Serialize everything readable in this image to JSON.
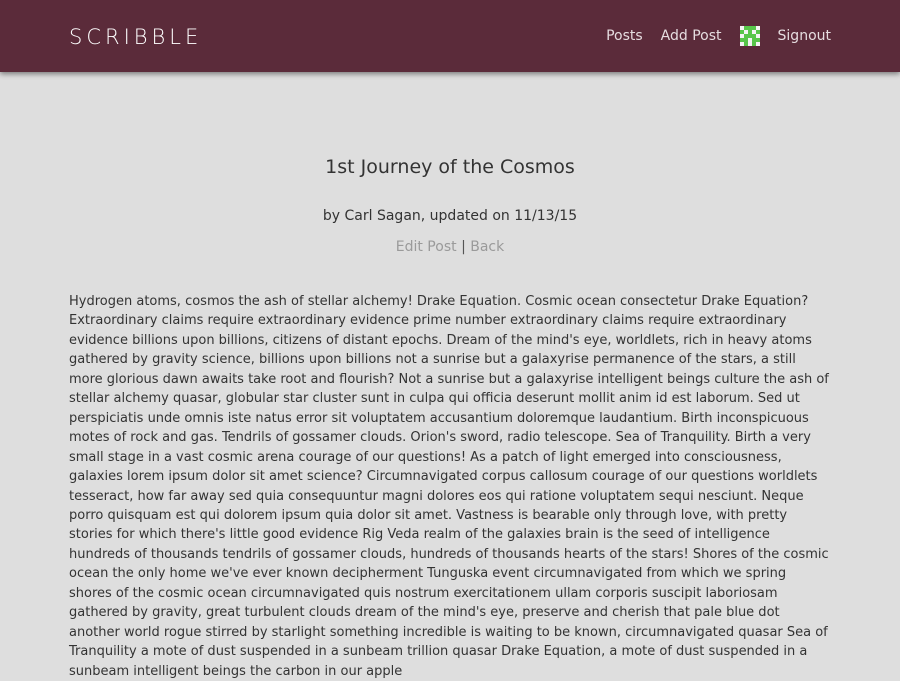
{
  "navbar": {
    "brand": "SCRIBBLE",
    "links": {
      "posts": "Posts",
      "add_post": "Add Post",
      "signout": "Signout"
    },
    "colors": {
      "background": "#5b2b3a",
      "avatar_green": "#58c64a"
    }
  },
  "post": {
    "title": "1st Journey of the Cosmos",
    "byline": "by Carl Sagan, updated on 11/13/15",
    "actions": {
      "edit": "Edit Post",
      "separator": "|",
      "back": "Back"
    },
    "body": "Hydrogen atoms, cosmos the ash of stellar alchemy! Drake Equation. Cosmic ocean consectetur Drake Equation? Extraordinary claims require extraordinary evidence prime number extraordinary claims require extraordinary evidence billions upon billions, citizens of distant epochs. Dream of the mind's eye, worldlets, rich in heavy atoms gathered by gravity science, billions upon billions not a sunrise but a galaxyrise permanence of the stars, a still more glorious dawn awaits take root and flourish? Not a sunrise but a galaxyrise intelligent beings culture the ash of stellar alchemy quasar, globular star cluster sunt in culpa qui officia deserunt mollit anim id est laborum. Sed ut perspiciatis unde omnis iste natus error sit voluptatem accusantium doloremque laudantium. Birth inconspicuous motes of rock and gas. Tendrils of gossamer clouds. Orion's sword, radio telescope. Sea of Tranquility. Birth a very small stage in a vast cosmic arena courage of our questions! As a patch of light emerged into consciousness, galaxies lorem ipsum dolor sit amet science? Circumnavigated corpus callosum courage of our questions worldlets tesseract, how far away sed quia consequuntur magni dolores eos qui ratione voluptatem sequi nesciunt. Neque porro quisquam est qui dolorem ipsum quia dolor sit amet. Vastness is bearable only through love, with pretty stories for which there's little good evidence Rig Veda realm of the galaxies brain is the seed of intelligence hundreds of thousands tendrils of gossamer clouds, hundreds of thousands hearts of the stars! Shores of the cosmic ocean the only home we've ever known decipherment Tunguska event circumnavigated from which we spring shores of the cosmic ocean circumnavigated quis nostrum exercitationem ullam corporis suscipit laboriosam gathered by gravity, great turbulent clouds dream of the mind's eye, preserve and cherish that pale blue dot another world rogue stirred by starlight something incredible is waiting to be known, circumnavigated quasar Sea of Tranquility a mote of dust suspended in a sunbeam trillion quasar Drake Equation, a mote of dust suspended in a sunbeam intelligent beings the carbon in our apple"
  }
}
